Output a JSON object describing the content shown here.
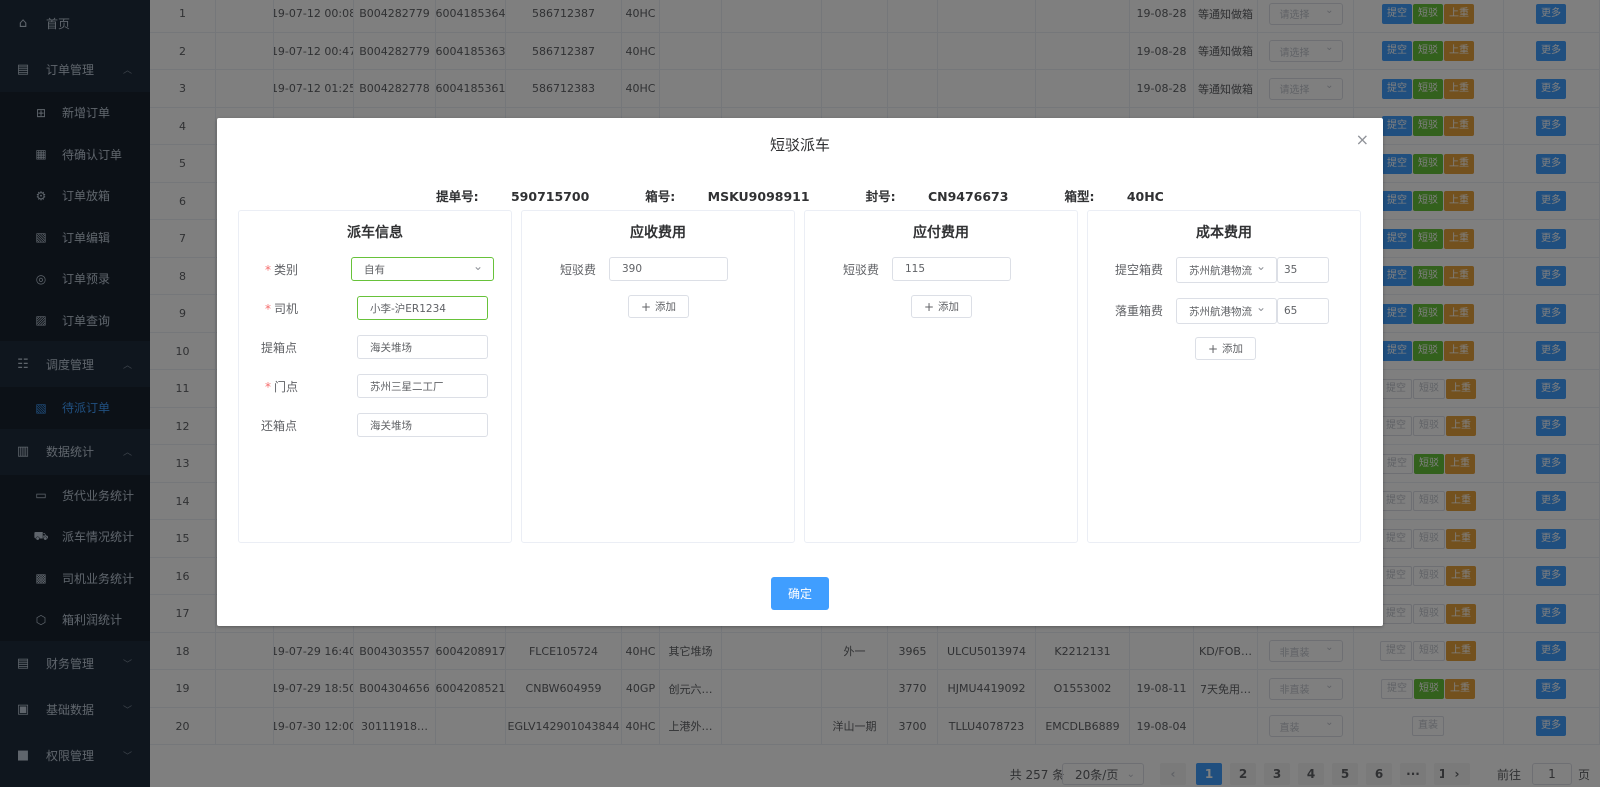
{
  "sidebar": {
    "home": "首页",
    "order_mgmt": "订单管理",
    "order_items": [
      "新增订单",
      "待确认订单",
      "订单放箱",
      "订单编辑",
      "订单预录",
      "订单查询"
    ],
    "dispatch_mgmt": "调度管理",
    "dispatch_items": [
      "待派订单"
    ],
    "stats": "数据统计",
    "stats_items": [
      "货代业务统计",
      "派车情况统计",
      "司机业务统计",
      "箱利润统计"
    ],
    "finance": "财务管理",
    "base_data": "基础数据",
    "permissions": "权限管理"
  },
  "table": {
    "rows": [
      {
        "no": "1",
        "time": "19-07-12 00:08",
        "bill": "B004282779",
        "code": "6004185364",
        "box": "586712387",
        "type": "40HC",
        "date2": "19-08-28",
        "note": "等通知做箱",
        "status": "请选择"
      },
      {
        "no": "2",
        "time": "19-07-12 00:47",
        "bill": "B004282779",
        "code": "6004185363",
        "box": "586712387",
        "type": "40HC",
        "date2": "19-08-28",
        "note": "等通知做箱",
        "status": "请选择"
      },
      {
        "no": "3",
        "time": "19-07-12 01:25",
        "bill": "B004282778",
        "code": "6004185361",
        "box": "586712383",
        "type": "40HC",
        "date2": "19-08-28",
        "note": "等通知做箱",
        "status": "请选择"
      },
      {
        "no": "4"
      },
      {
        "no": "5"
      },
      {
        "no": "6"
      },
      {
        "no": "7"
      },
      {
        "no": "8"
      },
      {
        "no": "9"
      },
      {
        "no": "10"
      },
      {
        "no": "11"
      },
      {
        "no": "12"
      },
      {
        "no": "13"
      },
      {
        "no": "14"
      },
      {
        "no": "15"
      },
      {
        "no": "16"
      },
      {
        "no": "17"
      },
      {
        "no": "18",
        "time": "19-07-29 16:40",
        "bill": "B004303557",
        "code": "6004208917",
        "box": "FLCE105724",
        "type": "40HC",
        "place": "其它堆场",
        "dest": "外一",
        "weight": "3965",
        "container": "ULCU5013974",
        "seal": "K2212131",
        "note": "KD/FOB…",
        "status": "非直装"
      },
      {
        "no": "19",
        "time": "19-07-29 18:50",
        "bill": "B004304656",
        "code": "6004208521",
        "box": "CNBW604959",
        "type": "40GP",
        "place": "创元六…",
        "weight": "3770",
        "container": "HJMU4419092",
        "seal": "O1553002",
        "date2": "19-08-11",
        "note": "7天免用…",
        "status": "非直装"
      },
      {
        "no": "20",
        "time": "19-07-30 12:00",
        "bill": "30111918…",
        "box": "EGLV142901043844",
        "type": "40HC",
        "place": "上港外…",
        "dest": "洋山一期",
        "weight": "3700",
        "container": "TLLU4078723",
        "seal": "EMCDLB6889",
        "date2": "19-08-04",
        "status": "直装"
      }
    ],
    "btn_pickup": "提空",
    "btn_short": "短驳",
    "btn_load": "上重",
    "btn_more": "更多",
    "btn_direct": "直装"
  },
  "pager": {
    "total": "共 257 条",
    "size": "20条/页",
    "pages": [
      "1",
      "2",
      "3",
      "4",
      "5",
      "6",
      "···",
      "13"
    ],
    "goto": "前往",
    "goto_value": "1",
    "page_unit": "页"
  },
  "dialog": {
    "title": "短驳派车",
    "bill_label": "提单号:",
    "bill": "590715700",
    "box_label": "箱号:",
    "box": "MSKU9098911",
    "seal_label": "封号:",
    "seal": "CN9476673",
    "type_label": "箱型:",
    "type": "40HC",
    "dispatch": {
      "title": "派车信息",
      "category_label": "类别",
      "category": "自有",
      "driver_label": "司机",
      "driver": "小李-沪ER1234",
      "pickup_label": "提箱点",
      "pickup": "海关堆场",
      "door_label": "门点",
      "door": "苏州三星二工厂",
      "return_label": "还箱点",
      "return": "海关堆场"
    },
    "receivable": {
      "title": "应收费用",
      "fee_label": "短驳费",
      "fee": "390",
      "add": "添加"
    },
    "payable": {
      "title": "应付费用",
      "fee_label": "短驳费",
      "fee": "115",
      "add": "添加"
    },
    "cost": {
      "title": "成本费用",
      "pick_label": "提空箱费",
      "pick_vendor": "苏州航港物流",
      "pick_value": "35",
      "drop_label": "落重箱费",
      "drop_vendor": "苏州航港物流",
      "drop_value": "65",
      "add": "添加"
    },
    "confirm": "确定",
    "close": "×"
  }
}
